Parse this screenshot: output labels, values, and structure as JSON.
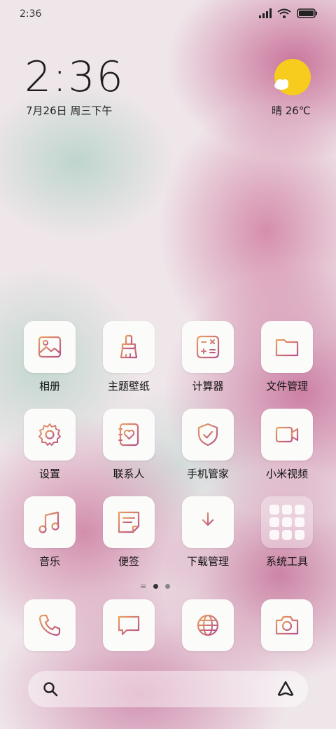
{
  "status_bar": {
    "time": "2:36"
  },
  "clock": {
    "time": "2:36",
    "date": "7月26日 周三下午"
  },
  "weather": {
    "text": "晴 26℃"
  },
  "icon_color": "#c05a8a",
  "apps": [
    {
      "label": "相册",
      "icon": "gallery-icon"
    },
    {
      "label": "主题壁纸",
      "icon": "brush-icon"
    },
    {
      "label": "计算器",
      "icon": "calculator-icon"
    },
    {
      "label": "文件管理",
      "icon": "folder-icon"
    },
    {
      "label": "设置",
      "icon": "gear-icon"
    },
    {
      "label": "联系人",
      "icon": "contacts-icon"
    },
    {
      "label": "手机管家",
      "icon": "shield-icon"
    },
    {
      "label": "小米视频",
      "icon": "video-icon"
    },
    {
      "label": "音乐",
      "icon": "music-icon"
    },
    {
      "label": "便签",
      "icon": "note-icon"
    },
    {
      "label": "下载管理",
      "icon": "download-icon"
    },
    {
      "label": "系统工具",
      "icon": "folder-group-icon"
    }
  ],
  "dock": [
    {
      "icon": "phone-icon"
    },
    {
      "icon": "message-icon"
    },
    {
      "icon": "browser-icon"
    },
    {
      "icon": "camera-icon"
    }
  ]
}
